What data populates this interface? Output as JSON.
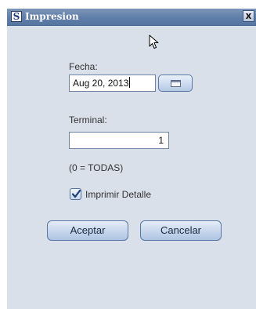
{
  "window": {
    "title": "Impresion",
    "app_icon": "S",
    "close_symbol": "x"
  },
  "form": {
    "fecha_label": "Fecha:",
    "fecha_value": "Aug 20, 2013",
    "terminal_label": "Terminal:",
    "terminal_value": "1",
    "terminal_hint": "(0 = TODAS)",
    "detalle_label": "Imprimir Detalle",
    "detalle_checked": true
  },
  "buttons": {
    "accept_label": "Aceptar",
    "cancel_label": "Cancelar"
  },
  "icons": {
    "calendar": "calendar-icon",
    "check": "checkmark-icon",
    "cursor": "mouse-pointer-icon"
  },
  "colors": {
    "title_bar": "#5f7ea8",
    "panel_bg": "#d9e0ea",
    "button_top": "#e4ecf7",
    "button_bottom": "#aec4e2"
  }
}
